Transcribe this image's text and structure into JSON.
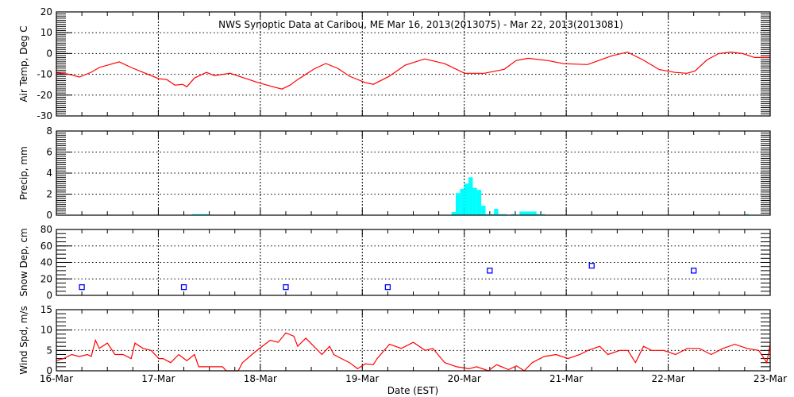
{
  "chart_data": {
    "title": "NWS Synoptic Data at Caribou, ME   Mar 16, 2013(2013075) - Mar 22, 2013(2013081)",
    "xlabel": "Date (EST)",
    "x_units": "hours since 16-Mar 00:00",
    "xlim": [
      0,
      168
    ],
    "x_tick_labels": [
      "16-Mar",
      "17-Mar",
      "18-Mar",
      "19-Mar",
      "20-Mar",
      "21-Mar",
      "22-Mar",
      "23-Mar"
    ],
    "panels": [
      {
        "type": "line",
        "name": "air-temp",
        "ylabel": "Air Temp, Deg C",
        "ylim": [
          -30,
          20
        ],
        "yticks": [
          20,
          10,
          0,
          -10,
          -20,
          -30
        ],
        "grid_y": [
          10,
          0,
          -10,
          -20
        ],
        "minor_step": 1,
        "color": "#ff0000",
        "x": [
          0,
          2.6,
          5.4,
          8.2,
          10.1,
          14.8,
          17.6,
          21.3,
          24.1,
          26,
          27.9,
          29.7,
          30.7,
          32.5,
          35.3,
          37.2,
          40.9,
          43.7,
          47.5,
          50.3,
          53.1,
          55,
          56.8,
          60.6,
          63.4,
          66.2,
          69,
          72.7,
          74.6,
          78.3,
          82.1,
          86.7,
          91.4,
          96.1,
          100.7,
          105.4,
          108.2,
          111,
          115.7,
          119.4,
          125,
          130.7,
          134.4,
          138.1,
          141.9,
          145.6,
          148.4,
          150.3,
          153.1,
          155.9,
          158.7,
          161.5,
          164.3,
          168
        ],
        "y": [
          -9.4,
          -9.8,
          -11.3,
          -9,
          -6.7,
          -4,
          -6.7,
          -9.8,
          -12.1,
          -12.5,
          -15.2,
          -14.8,
          -16,
          -11.8,
          -9.1,
          -10.6,
          -9.5,
          -11.4,
          -14,
          -15.6,
          -17.1,
          -15.2,
          -12.5,
          -7.5,
          -4.8,
          -7.1,
          -10.9,
          -14,
          -14.8,
          -11,
          -5.6,
          -2.6,
          -4.9,
          -9.5,
          -9.5,
          -7.6,
          -3.4,
          -2.3,
          -3.4,
          -4.9,
          -5.3,
          -1.1,
          0.7,
          -3.1,
          -7.7,
          -9.1,
          -9.5,
          -8.4,
          -3.1,
          0,
          0.7,
          0,
          -1.9,
          -1.9
        ]
      },
      {
        "type": "bar",
        "name": "precip",
        "ylabel": "Precip, mm",
        "ylim": [
          0,
          8
        ],
        "yticks": [
          8,
          6,
          4,
          2,
          0
        ],
        "grid_y": [
          2,
          4,
          6
        ],
        "minor_step": 0.2,
        "color": "#00ffff",
        "x": [
          32,
          33,
          34,
          35,
          93,
          94,
          95,
          96,
          97,
          98,
          99,
          100,
          101,
          102,
          103,
          104,
          105,
          107,
          109,
          110,
          111,
          112,
          113,
          114,
          162
        ],
        "y": [
          0.1,
          0.1,
          0.1,
          0.1,
          0.3,
          2.1,
          2.5,
          3.0,
          3.6,
          2.6,
          2.4,
          0.9,
          0.1,
          0.1,
          0.6,
          0.1,
          0.1,
          0.1,
          0.35,
          0.35,
          0.35,
          0.35,
          0.1,
          0.1,
          0.1
        ]
      },
      {
        "type": "scatter",
        "name": "snow-depth",
        "ylabel": "Snow Dep, cm",
        "ylim": [
          0,
          80
        ],
        "yticks": [
          80,
          60,
          40,
          20,
          0
        ],
        "grid_y": [
          20,
          40,
          60
        ],
        "minor_step": 5,
        "color": "#0000ff",
        "x": [
          6,
          30,
          54,
          78,
          102,
          126,
          150
        ],
        "y": [
          10,
          10,
          10,
          10,
          30,
          36,
          30
        ]
      },
      {
        "type": "line",
        "name": "wind-speed",
        "ylabel": "Wind Spd, m/s",
        "ylim": [
          0,
          15
        ],
        "yticks": [
          15,
          10,
          5,
          0
        ],
        "grid_y": [
          5,
          10
        ],
        "minor_step": 1,
        "color": "#ff0000",
        "x": [
          0,
          1.7,
          3.6,
          5.4,
          7.3,
          8.2,
          9.2,
          10.1,
          12,
          13.8,
          15.7,
          17.6,
          18.5,
          20.4,
          22.3,
          24.1,
          25.1,
          26.9,
          28.8,
          30.7,
          32.5,
          33.5,
          39.1,
          40,
          42.8,
          43.8,
          46.6,
          50.3,
          52.2,
          54,
          55.9,
          56.8,
          58.7,
          60.6,
          62.5,
          64.3,
          65.3,
          67.1,
          69,
          70.9,
          72.7,
          74.6,
          75.5,
          78.4,
          81.2,
          84,
          86.8,
          88.6,
          91.4,
          94.2,
          97.1,
          98.9,
          101.7,
          103.6,
          106.4,
          108.3,
          110.1,
          112,
          114.8,
          117.6,
          120.4,
          123.2,
          125.1,
          127.9,
          129.8,
          132.6,
          134.5,
          136.3,
          138.2,
          140.1,
          142.9,
          145.7,
          148.5,
          151.3,
          154.1,
          156.9,
          159.7,
          162.5,
          165.3,
          167.2,
          168
        ],
        "y": [
          2.5,
          3,
          4,
          3.5,
          4,
          3.5,
          7.5,
          5.5,
          6.8,
          4,
          4,
          3,
          6.8,
          5.5,
          5,
          3,
          3,
          2,
          4,
          2.5,
          4,
          1,
          1,
          0,
          0,
          2,
          4.5,
          7.5,
          7,
          9.3,
          8.5,
          6,
          8,
          6,
          4,
          6,
          4,
          3,
          2,
          0.5,
          1.7,
          1.5,
          3,
          6.5,
          5.5,
          7,
          5,
          5.5,
          2,
          1,
          0.5,
          1,
          0,
          1.5,
          0.3,
          1.2,
          0,
          2,
          3.5,
          4,
          3,
          4,
          5,
          6,
          4,
          5,
          5,
          2,
          6,
          5,
          5,
          4,
          5.5,
          5.5,
          4,
          5.5,
          6.5,
          5.5,
          5,
          2,
          6.5
        ]
      }
    ]
  }
}
